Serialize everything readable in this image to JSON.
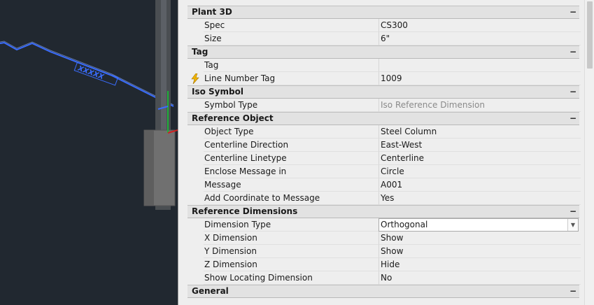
{
  "palette": {
    "categories": [
      {
        "name": "Plant 3D",
        "rows": [
          {
            "name": "Spec",
            "value": "CS300"
          },
          {
            "name": "Size",
            "value": "6\""
          }
        ]
      },
      {
        "name": "Tag",
        "rows": [
          {
            "name": "Tag",
            "value": ""
          },
          {
            "name": "Line Number Tag",
            "value": "1009",
            "icon": "lightning-bolt-icon"
          }
        ]
      },
      {
        "name": "Iso Symbol",
        "rows": [
          {
            "name": "Symbol Type",
            "value": "Iso Reference Dimension",
            "greyed": true
          }
        ]
      },
      {
        "name": "Reference Object",
        "rows": [
          {
            "name": "Object Type",
            "value": "Steel Column"
          },
          {
            "name": "Centerline Direction",
            "value": "East-West"
          },
          {
            "name": "Centerline Linetype",
            "value": "Centerline"
          },
          {
            "name": "Enclose Message in",
            "value": "Circle"
          },
          {
            "name": "Message",
            "value": "A001"
          },
          {
            "name": "Add Coordinate to Message",
            "value": "Yes"
          }
        ]
      },
      {
        "name": "Reference Dimensions",
        "rows": [
          {
            "name": "Dimension Type",
            "value": "Orthogonal",
            "dropdown": true
          },
          {
            "name": "X Dimension",
            "value": "Show"
          },
          {
            "name": "Y Dimension",
            "value": "Show"
          },
          {
            "name": "Z Dimension",
            "value": "Hide"
          },
          {
            "name": "Show Locating Dimension",
            "value": "No"
          }
        ]
      },
      {
        "name": "General",
        "rows": []
      }
    ],
    "collapse_symbol": "−"
  },
  "viewport": {
    "pipe_label": "XXXXX",
    "colors": {
      "pipe": "#2f6bff",
      "background": "#212830",
      "column": "#6a6a6a"
    }
  }
}
